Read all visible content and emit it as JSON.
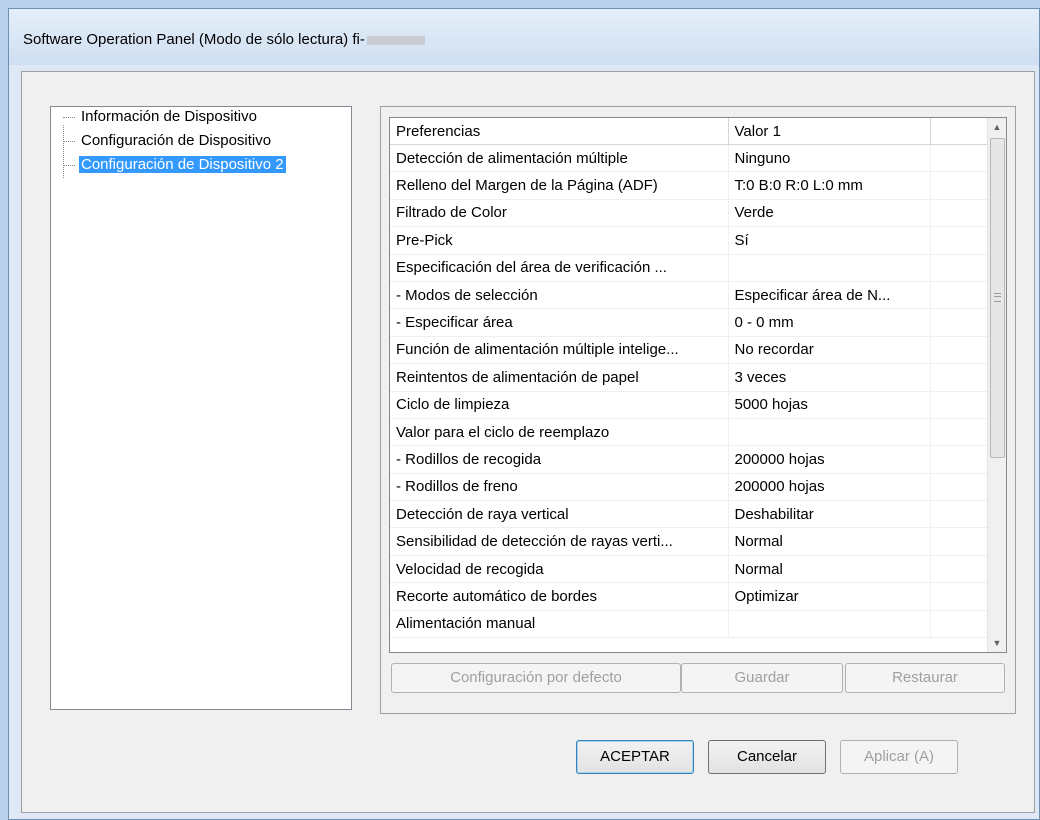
{
  "window": {
    "title": "Software Operation Panel (Modo de sólo lectura) fi-"
  },
  "tree": {
    "items": [
      {
        "label": "Información de Dispositivo",
        "selected": false
      },
      {
        "label": "Configuración de Dispositivo",
        "selected": false
      },
      {
        "label": "Configuración de Dispositivo 2",
        "selected": true
      }
    ]
  },
  "grid": {
    "columns": [
      "Preferencias",
      "Valor 1",
      ""
    ],
    "rows": [
      [
        "Detección de alimentación múltiple",
        "Ninguno"
      ],
      [
        "Relleno del Margen de la Página (ADF)",
        "T:0  B:0  R:0  L:0 mm"
      ],
      [
        "Filtrado de Color",
        "Verde"
      ],
      [
        "Pre-Pick",
        "Sí"
      ],
      [
        "Especificación del área de verificación ...",
        ""
      ],
      [
        " - Modos de selección",
        "Especificar área de N..."
      ],
      [
        " - Especificar área",
        "0 - 0 mm"
      ],
      [
        "Función de alimentación múltiple intelige...",
        "  No recordar"
      ],
      [
        "Reintentos de alimentación de papel",
        "3 veces"
      ],
      [
        "Ciclo de limpieza",
        "5000 hojas"
      ],
      [
        "Valor para el ciclo de reemplazo",
        ""
      ],
      [
        " - Rodillos de recogida",
        "200000 hojas"
      ],
      [
        " - Rodillos de freno",
        "200000 hojas"
      ],
      [
        "Detección de raya vertical",
        "Deshabilitar"
      ],
      [
        "Sensibilidad de detección de rayas verti...",
        "Normal"
      ],
      [
        "Velocidad de recogida",
        "Normal"
      ],
      [
        "Recorte automático de bordes",
        "Optimizar"
      ],
      [
        "Alimentación manual",
        ""
      ]
    ]
  },
  "grid_buttons": {
    "defaults": "Configuración por defecto",
    "save": "Guardar",
    "restore": "Restaurar"
  },
  "dialog_buttons": {
    "ok": "ACEPTAR",
    "cancel": "Cancelar",
    "apply": "Aplicar (A)"
  },
  "icons": {
    "scroll_up": "▲",
    "scroll_down": "▼"
  },
  "colors": {
    "selection": "#3399ff",
    "window_frame": "#b9d1ea"
  }
}
